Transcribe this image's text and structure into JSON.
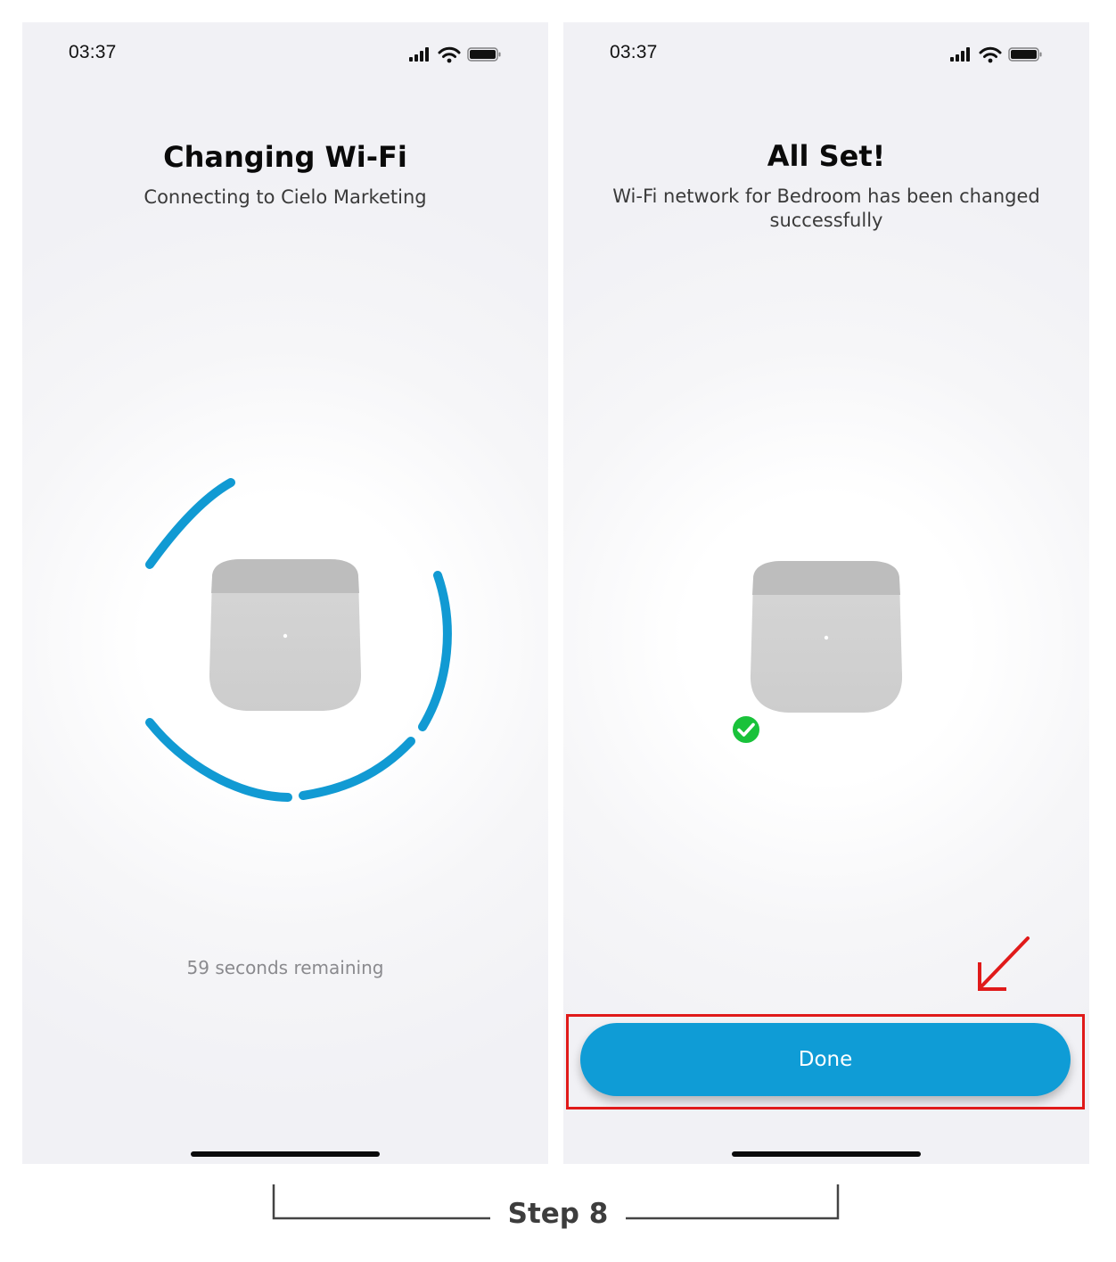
{
  "left_screen": {
    "status": {
      "time": "03:37"
    },
    "title": "Changing Wi-Fi",
    "subtitle": "Connecting to  Cielo Marketing",
    "remaining": "59 seconds remaining"
  },
  "right_screen": {
    "status": {
      "time": "03:37"
    },
    "title": "All Set!",
    "subtitle": "Wi-Fi network for Bedroom has been changed successfully",
    "done_label": "Done"
  },
  "step_label": "Step 8",
  "colors": {
    "accent": "#0f9cd6",
    "success": "#19c23a",
    "highlight": "#e01a1a"
  }
}
